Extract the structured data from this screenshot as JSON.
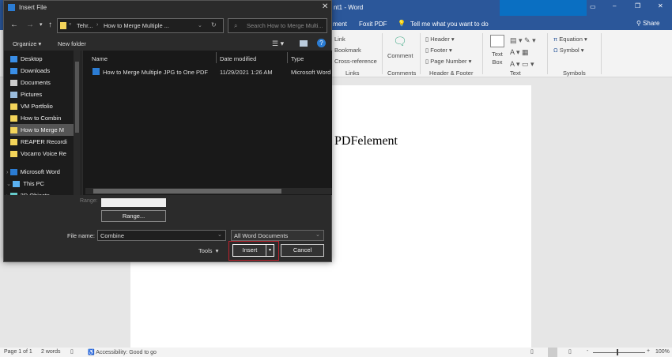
{
  "word": {
    "title": "Document1 - Word",
    "title_visible": "nt1  -  Word",
    "tabs": [
      "ment",
      "Foxit PDF"
    ],
    "tellme": "Tell me what you want to do",
    "share": "Share",
    "ribbon": {
      "links": [
        "Link",
        "Bookmark",
        "Cross-reference"
      ],
      "links_group": "Links",
      "comment": "Comment",
      "comments_group": "Comments",
      "hf": [
        "Header",
        "Footer",
        "Page Number"
      ],
      "hf_group": "Header & Footer",
      "textbox": "Text Box",
      "text_group": "Text",
      "symbols": [
        "Equation",
        "Symbol"
      ],
      "symbols_group": "Symbols"
    },
    "doc_text": "PDFelement",
    "status": {
      "page": "Page 1 of 1",
      "words": "2 words",
      "accessibility": "Accessibility: Good to go",
      "zoom": "100%"
    }
  },
  "dialog": {
    "title": "Insert File",
    "breadcrumb": [
      "Tehr...",
      "How to Merge Multiple ..."
    ],
    "search_placeholder": "Search How to Merge Multi...",
    "organize": "Organize",
    "new_folder": "New folder",
    "nav": [
      {
        "label": "Desktop",
        "icon": "desktop-icon"
      },
      {
        "label": "Downloads",
        "icon": "download-icon"
      },
      {
        "label": "Documents",
        "icon": "documents-icon"
      },
      {
        "label": "Pictures",
        "icon": "pictures-icon"
      },
      {
        "label": "VM Portfolio",
        "icon": "folder-icon"
      },
      {
        "label": "How to Combin",
        "icon": "folder-icon"
      },
      {
        "label": "How to Merge M",
        "icon": "folder-icon",
        "selected": true
      },
      {
        "label": "REAPER Recordi",
        "icon": "folder-icon"
      },
      {
        "label": "Vocarro Voice Re",
        "icon": "folder-icon"
      },
      {
        "label": "Microsoft Word",
        "icon": "word-icon"
      },
      {
        "label": "This PC",
        "icon": "pc-icon"
      },
      {
        "label": "3D Objects",
        "icon": "3d-icon"
      }
    ],
    "columns": [
      "Name",
      "Date modified",
      "Type"
    ],
    "files": [
      {
        "name": "How to Merge Multiple JPG to One PDF",
        "date": "11/29/2021 1:26 AM",
        "type": "Microsoft Word"
      }
    ],
    "range_label": "Range:",
    "range_button": "Range...",
    "filename_label": "File name:",
    "filename": "Combine",
    "filetype": "All Word Documents",
    "tools": "Tools",
    "insert": "Insert",
    "cancel": "Cancel"
  }
}
